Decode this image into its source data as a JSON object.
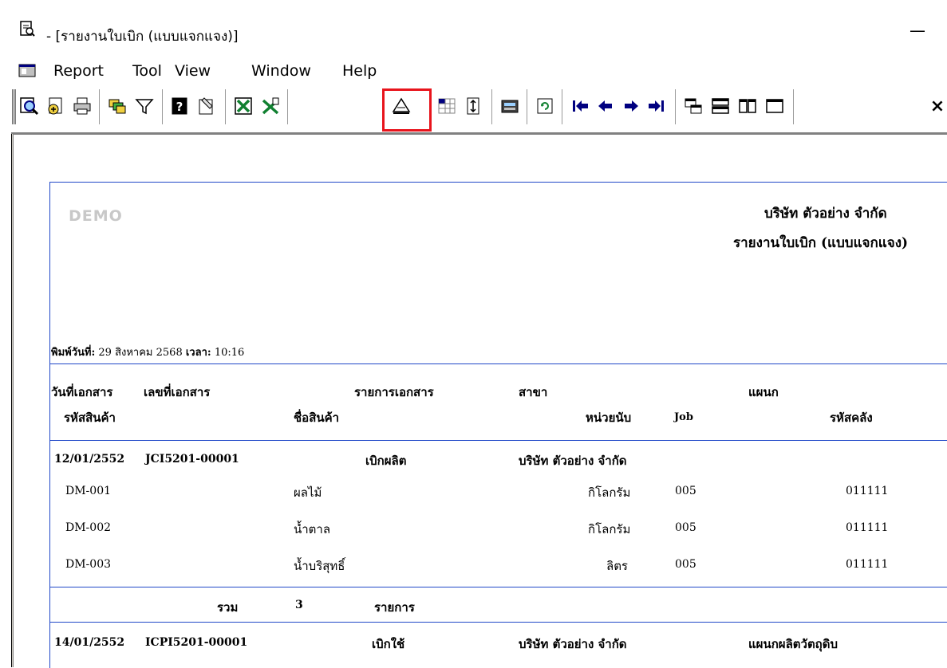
{
  "window": {
    "title": "- [รายงานใบเบิก (แบบแจกแจง)]",
    "minimize_glyph": "—"
  },
  "menu": [
    "Report",
    "Tool",
    "View",
    "Window",
    "Help"
  ],
  "toolbar": {
    "close_glyph": "×",
    "buttons": [
      "preview-icon",
      "export-icon",
      "print-icon",
      "group-icon",
      "filter-icon",
      "design-icon",
      "edit-icon",
      "excel-icon",
      "excel-x-icon",
      "page-setup-icon",
      "grid-icon",
      "row-height-icon",
      "calculator-icon",
      "refresh-icon",
      "first-page-icon",
      "prev-page-icon",
      "next-page-icon",
      "last-page-icon",
      "cascade-icon",
      "tile-horizontal-icon",
      "tile-vertical-icon",
      "maximize-icon"
    ]
  },
  "report": {
    "watermark": "DEMO",
    "company": "บริษัท ตัวอย่าง จำกัด",
    "title": "รายงานใบเบิก (แบบแจกแจง)",
    "printed_label": "พิมพ์วันที่:",
    "printed_date": "29 สิงหาคม 2568",
    "time_label": "เวลา:",
    "printed_time": "10:16",
    "headers_row1": {
      "doc_date": "วันที่เอกสาร",
      "doc_no": "เลขที่เอกสาร",
      "doc_list": "รายการเอกสาร",
      "branch": "สาขา",
      "department": "แผนก"
    },
    "headers_row2": {
      "product_code": "รหัสสินค้า",
      "product_name": "ชื่อสินค้า",
      "unit": "หน่วยนับ",
      "job": "Job",
      "warehouse": "รหัสคลัง"
    },
    "doc1": {
      "date": "12/01/2552",
      "number": "JCI5201-00001",
      "type": "เบิกผลิต",
      "branch": "บริษัท ตัวอย่าง จำกัด",
      "items": [
        {
          "code": "DM-001",
          "name": "ผลไม้",
          "unit": "กิโลกรัม",
          "job": "005",
          "warehouse": "011111"
        },
        {
          "code": "DM-002",
          "name": "น้ำตาล",
          "unit": "กิโลกรัม",
          "job": "005",
          "warehouse": "011111"
        },
        {
          "code": "DM-003",
          "name": "น้ำบริสุทธิ์",
          "unit": "ลิตร",
          "job": "005",
          "warehouse": "011111"
        }
      ],
      "total_label": "รวม",
      "total_count": "3",
      "total_unit": "รายการ"
    },
    "doc2": {
      "date": "14/01/2552",
      "number": "ICPI5201-00001",
      "type": "เบิกใช้",
      "branch": "บริษัท ตัวอย่าง จำกัด",
      "department": "แผนกผลิตวัตถุดิบ"
    }
  }
}
